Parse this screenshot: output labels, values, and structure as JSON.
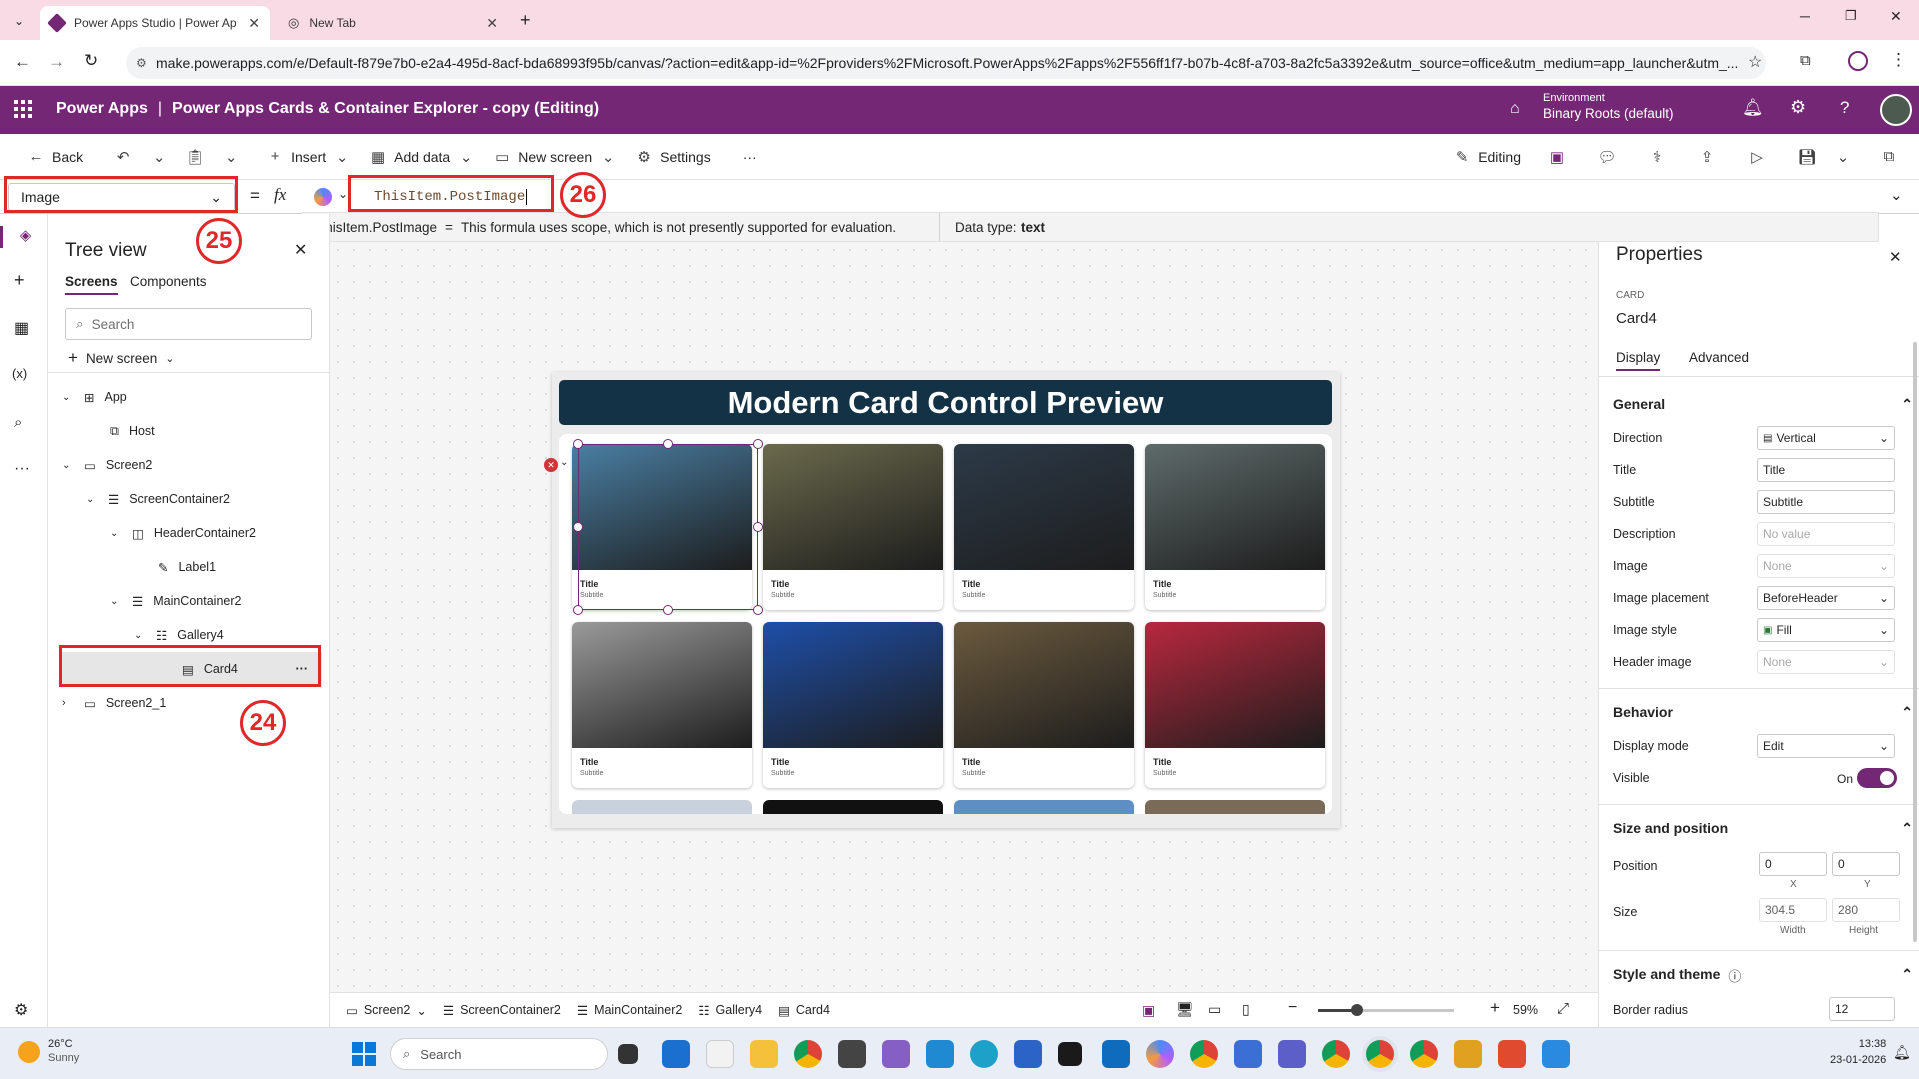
{
  "browser": {
    "tabs": [
      {
        "title": "Power Apps Studio | Power Ap",
        "active": true
      },
      {
        "title": "New Tab",
        "active": false
      }
    ],
    "url": "make.powerapps.com/e/Default-f879e7b0-e2a4-495d-8acf-bda68993f95b/canvas/?action=edit&app-id=%2Fproviders%2FMicrosoft.PowerApps%2Fapps%2F556ff1f7-b07b-4c8f-a703-8a2fc5a3392e&utm_source=office&utm_medium=app_launcher&utm_..."
  },
  "appbar": {
    "product": "Power Apps",
    "separator": "|",
    "app_title": "Power Apps Cards & Container Explorer - copy (Editing)",
    "env_label": "Environment",
    "env_name": "Binary Roots (default)"
  },
  "toolbar": {
    "back": "Back",
    "insert": "Insert",
    "add_data": "Add data",
    "new_screen": "New screen",
    "settings": "Settings",
    "more": "···",
    "editing": "Editing"
  },
  "formula": {
    "property": "Image",
    "equals": "=",
    "fx": "fx",
    "value": "ThisItem.PostImage",
    "hint_expr": "ThisItem.PostImage",
    "hint_eq": "=",
    "hint_msg": "This formula uses scope, which is not presently supported for evaluation.",
    "datatype_label": "Data type:",
    "datatype_value": "text"
  },
  "annotations": {
    "a24": "24",
    "a25": "25",
    "a26": "26"
  },
  "tree": {
    "title": "Tree view",
    "tab_screens": "Screens",
    "tab_components": "Components",
    "search_placeholder": "Search",
    "new_screen": "New screen",
    "nodes": [
      {
        "label": "App"
      },
      {
        "label": "Host"
      },
      {
        "label": "Screen2"
      },
      {
        "label": "ScreenContainer2"
      },
      {
        "label": "HeaderContainer2"
      },
      {
        "label": "Label1"
      },
      {
        "label": "MainContainer2"
      },
      {
        "label": "Gallery4"
      },
      {
        "label": "Card4"
      },
      {
        "label": "Screen2_1"
      }
    ]
  },
  "preview": {
    "header": "Modern Card Control Preview",
    "card_title": "Title",
    "card_subtitle": "Subtitle",
    "card_colors": [
      "#4a7fa3",
      "#6b6a4c",
      "#2c3a48",
      "#5e6b6a",
      "#9a9a9a",
      "#1e4fa8",
      "#6b5a3e",
      "#b8283e"
    ]
  },
  "properties": {
    "title": "Properties",
    "kind": "CARD",
    "name": "Card4",
    "tab_display": "Display",
    "tab_advanced": "Advanced",
    "sec_general": "General",
    "direction_label": "Direction",
    "direction_value": "Vertical",
    "title_label": "Title",
    "title_value": "Title",
    "subtitle_label": "Subtitle",
    "subtitle_value": "Subtitle",
    "description_label": "Description",
    "description_value": "No value",
    "image_label": "Image",
    "image_value": "None",
    "placement_label": "Image placement",
    "placement_value": "BeforeHeader",
    "style_label": "Image style",
    "style_value": "Fill",
    "header_image_label": "Header image",
    "header_image_value": "None",
    "sec_behavior": "Behavior",
    "display_mode_label": "Display mode",
    "display_mode_value": "Edit",
    "visible_label": "Visible",
    "visible_value": "On",
    "sec_size": "Size and position",
    "position_label": "Position",
    "pos_x": "0",
    "pos_y": "0",
    "x_cap": "X",
    "y_cap": "Y",
    "size_label": "Size",
    "width_value": "304.5",
    "height_value": "280",
    "width_cap": "Width",
    "height_cap": "Height",
    "sec_style": "Style and theme",
    "radius_label": "Border radius",
    "radius_value": "12"
  },
  "statusbar": {
    "crumbs": [
      "Screen2",
      "ScreenContainer2",
      "MainContainer2",
      "Gallery4",
      "Card4"
    ],
    "zoom": "59%",
    "zoom_level": 0.59
  },
  "taskbar": {
    "temp": "26°C",
    "weather": "Sunny",
    "search": "Search",
    "time": "13:38",
    "date": "23-01-2026"
  }
}
